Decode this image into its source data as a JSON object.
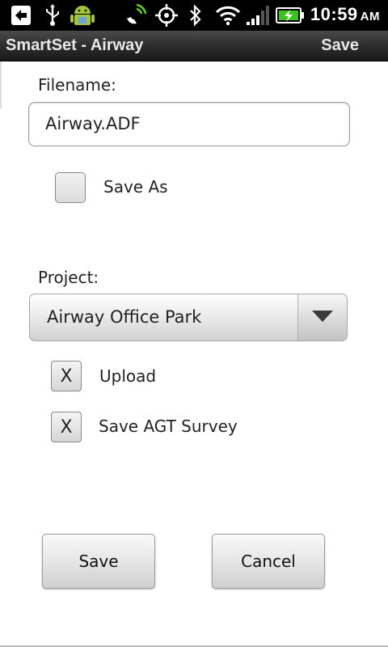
{
  "status_bar": {
    "icons": [
      "back-arrow-icon",
      "usb-icon",
      "android-debug-icon",
      "gps-phone-icon",
      "gps-target-icon",
      "bluetooth-icon",
      "wifi-icon",
      "signal-icon",
      "battery-charging-icon"
    ],
    "time": "10:59",
    "ampm": "AM"
  },
  "title_bar": {
    "title": "SmartSet - Airway",
    "action": "Save"
  },
  "form": {
    "filename_label": "Filename:",
    "filename_value": "Airway.ADF",
    "save_as_label": "Save As",
    "save_as_checked": false,
    "project_label": "Project:",
    "project_value": "Airway Office Park",
    "upload_label": "Upload",
    "upload_mark": "X",
    "save_agt_label": "Save AGT Survey",
    "save_agt_mark": "X"
  },
  "buttons": {
    "save": "Save",
    "cancel": "Cancel"
  }
}
